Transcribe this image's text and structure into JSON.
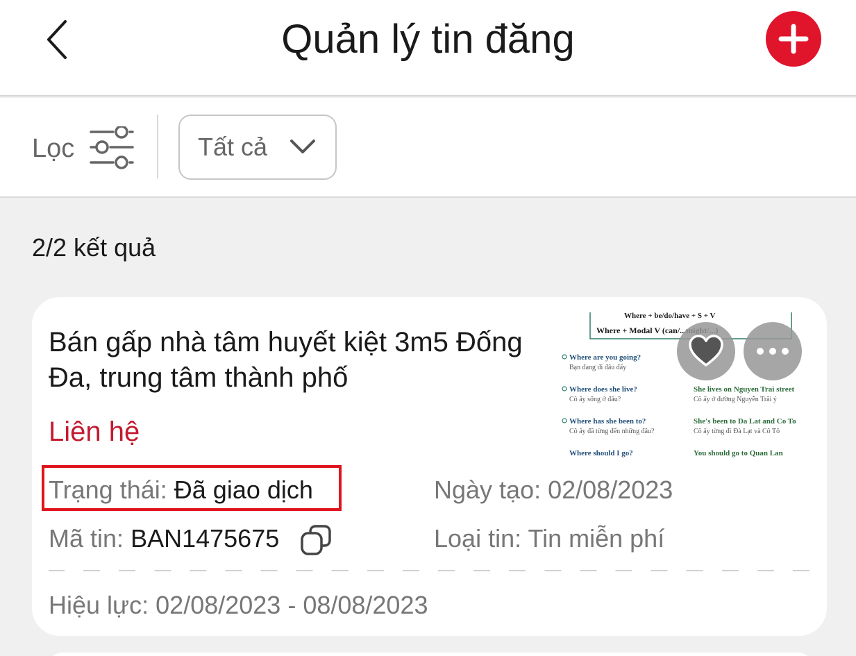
{
  "header": {
    "title": "Quản lý tin đăng",
    "back_icon": "chevron-left-icon",
    "add_icon": "plus-icon",
    "accent_color": "#e0142b"
  },
  "filter": {
    "label": "Lọc",
    "icon": "sliders-icon",
    "select_value": "Tất cả"
  },
  "results": {
    "count_text": "2/2 kết quả"
  },
  "listing": {
    "title": "Bán gấp nhà tâm huyết kiệt 3m5 Đống Đa, trung tâm thành phố",
    "price": "Liên hệ",
    "status_label": "Trạng thái:",
    "status_value": "Đã giao dịch",
    "created_label": "Ngày tạo:",
    "created_value": "02/08/2023",
    "code_label": "Mã tin:",
    "code_value": "BAN1475675",
    "type_label": "Loại tin:",
    "type_value": "Tin miễn phí",
    "validity_label": "Hiệu lực:",
    "validity_value": "02/08/2023 - 08/08/2023",
    "thumbnail": {
      "line1": "Where + be/do/have + S + V",
      "line2": "Where + Modal V (can/...might/...)",
      "rows": [
        {
          "q": "Where are you going?",
          "q_vi": "Bạn đang đi đâu đấy",
          "a": "",
          "a_vi": ""
        },
        {
          "q": "Where does she live?",
          "q_vi": "Cô ấy sống ở đâu?",
          "a": "She lives on Nguyen Trai street",
          "a_vi": "Cô ấy ở đường Nguyễn Trãi ý"
        },
        {
          "q": "Where has she been to?",
          "q_vi": "Cô ấy đã từng đến những đâu?",
          "a": "She's been to Da Lat and Co To",
          "a_vi": "Cô ấy từng đi Đà Lạt và Cô Tô"
        },
        {
          "q": "Where should I go?",
          "q_vi": "",
          "a": "You should go to Quan Lan",
          "a_vi": ""
        }
      ]
    }
  }
}
